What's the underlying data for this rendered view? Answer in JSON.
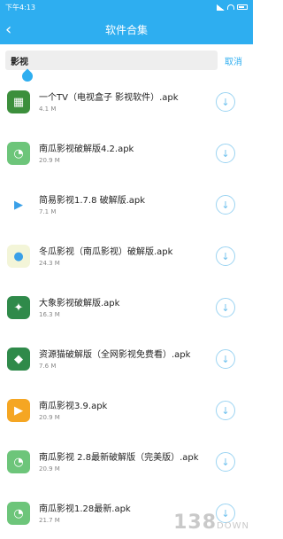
{
  "status": {
    "time": "下午4:13"
  },
  "header": {
    "title": "软件合集",
    "back_icon": "chevron-left-icon"
  },
  "search": {
    "query": "影视",
    "cancel_label": "取消"
  },
  "items": [
    {
      "name": "一个TV（电视盒子 影视软件）.apk",
      "size": "4.1 M",
      "icon": "film-icon",
      "color": "#3c8f3c"
    },
    {
      "name": "南瓜影视破解版4.2.apk",
      "size": "20.9 M",
      "icon": "android-icon",
      "color": "#6dc57a"
    },
    {
      "name": "简易影视1.7.8 破解版.apk",
      "size": "7.1 M",
      "icon": "play-icon",
      "color": "#ffffff"
    },
    {
      "name": "冬瓜影视（南瓜影视）破解版.apk",
      "size": "24.3 M",
      "icon": "melon-icon",
      "color": "#f3f5d8"
    },
    {
      "name": "大象影视破解版.apk",
      "size": "16.3 M",
      "icon": "elephant-icon",
      "color": "#2f8a4a"
    },
    {
      "name": "资源猫破解版（全网影视免费看）.apk",
      "size": "7.6 M",
      "icon": "cat-icon",
      "color": "#2f8a4a"
    },
    {
      "name": "南瓜影视3.9.apk",
      "size": "20.9 M",
      "icon": "pumpkin-play-icon",
      "color": "#f5a623"
    },
    {
      "name": "南瓜影视 2.8最新破解版（完美版）.apk",
      "size": "20.9 M",
      "icon": "android-icon",
      "color": "#6dc57a"
    },
    {
      "name": "南瓜影视1.28最新.apk",
      "size": "21.7 M",
      "icon": "android-icon",
      "color": "#6dc57a"
    }
  ],
  "watermark": {
    "text": "138",
    "sub": "DOWN"
  }
}
